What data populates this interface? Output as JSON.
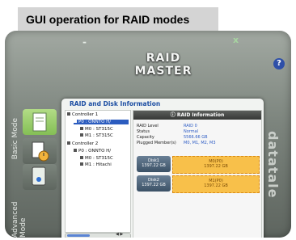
{
  "caption": "GUI operation for RAID modes",
  "window": {
    "minimize_glyph": "-",
    "close_glyph": "x",
    "brand": "RAID MASTER",
    "help_glyph": "?"
  },
  "side_tabs": {
    "basic": "Basic Mode",
    "advanced": "Advanced Mode"
  },
  "watermark": "datatale",
  "panel": {
    "title": "RAID and Disk Information",
    "tree": [
      {
        "label": "Controller 1",
        "level": 0
      },
      {
        "label": "P0 : ONNTO H/",
        "level": 1,
        "selected": true
      },
      {
        "label": "M0 : ST315C",
        "level": 2
      },
      {
        "label": "M1 : ST315C",
        "level": 2
      },
      {
        "label": "Controller 2",
        "level": 0
      },
      {
        "label": "P0 : ONNTO H/",
        "level": 1
      },
      {
        "label": "M0 : ST315C",
        "level": 2
      },
      {
        "label": "M1 : Hitachi",
        "level": 2
      }
    ],
    "scroll_arrows": "◀ ▶"
  },
  "info": {
    "header": "RAID Information",
    "rows": [
      {
        "label": "RAID Level",
        "value": "RAID 0"
      },
      {
        "label": "Status",
        "value": "Normal"
      },
      {
        "label": "Capacity",
        "value": "5566.66 GB"
      },
      {
        "label": "Plugged Member(s)",
        "value": "M0, M1, M2, M3"
      }
    ],
    "disks": [
      {
        "name": "Disk1",
        "size": "1397.22 GB",
        "member": "M0(P0)",
        "member_size": "1397.22 GB"
      },
      {
        "name": "Disk2",
        "size": "1397.22 GB",
        "member": "M1(P0)",
        "member_size": "1397.22 GB"
      }
    ]
  },
  "colors": {
    "accent": "#2b5cbf",
    "raid_block": "#f8c04a",
    "active_tab": "#a6d47a"
  }
}
